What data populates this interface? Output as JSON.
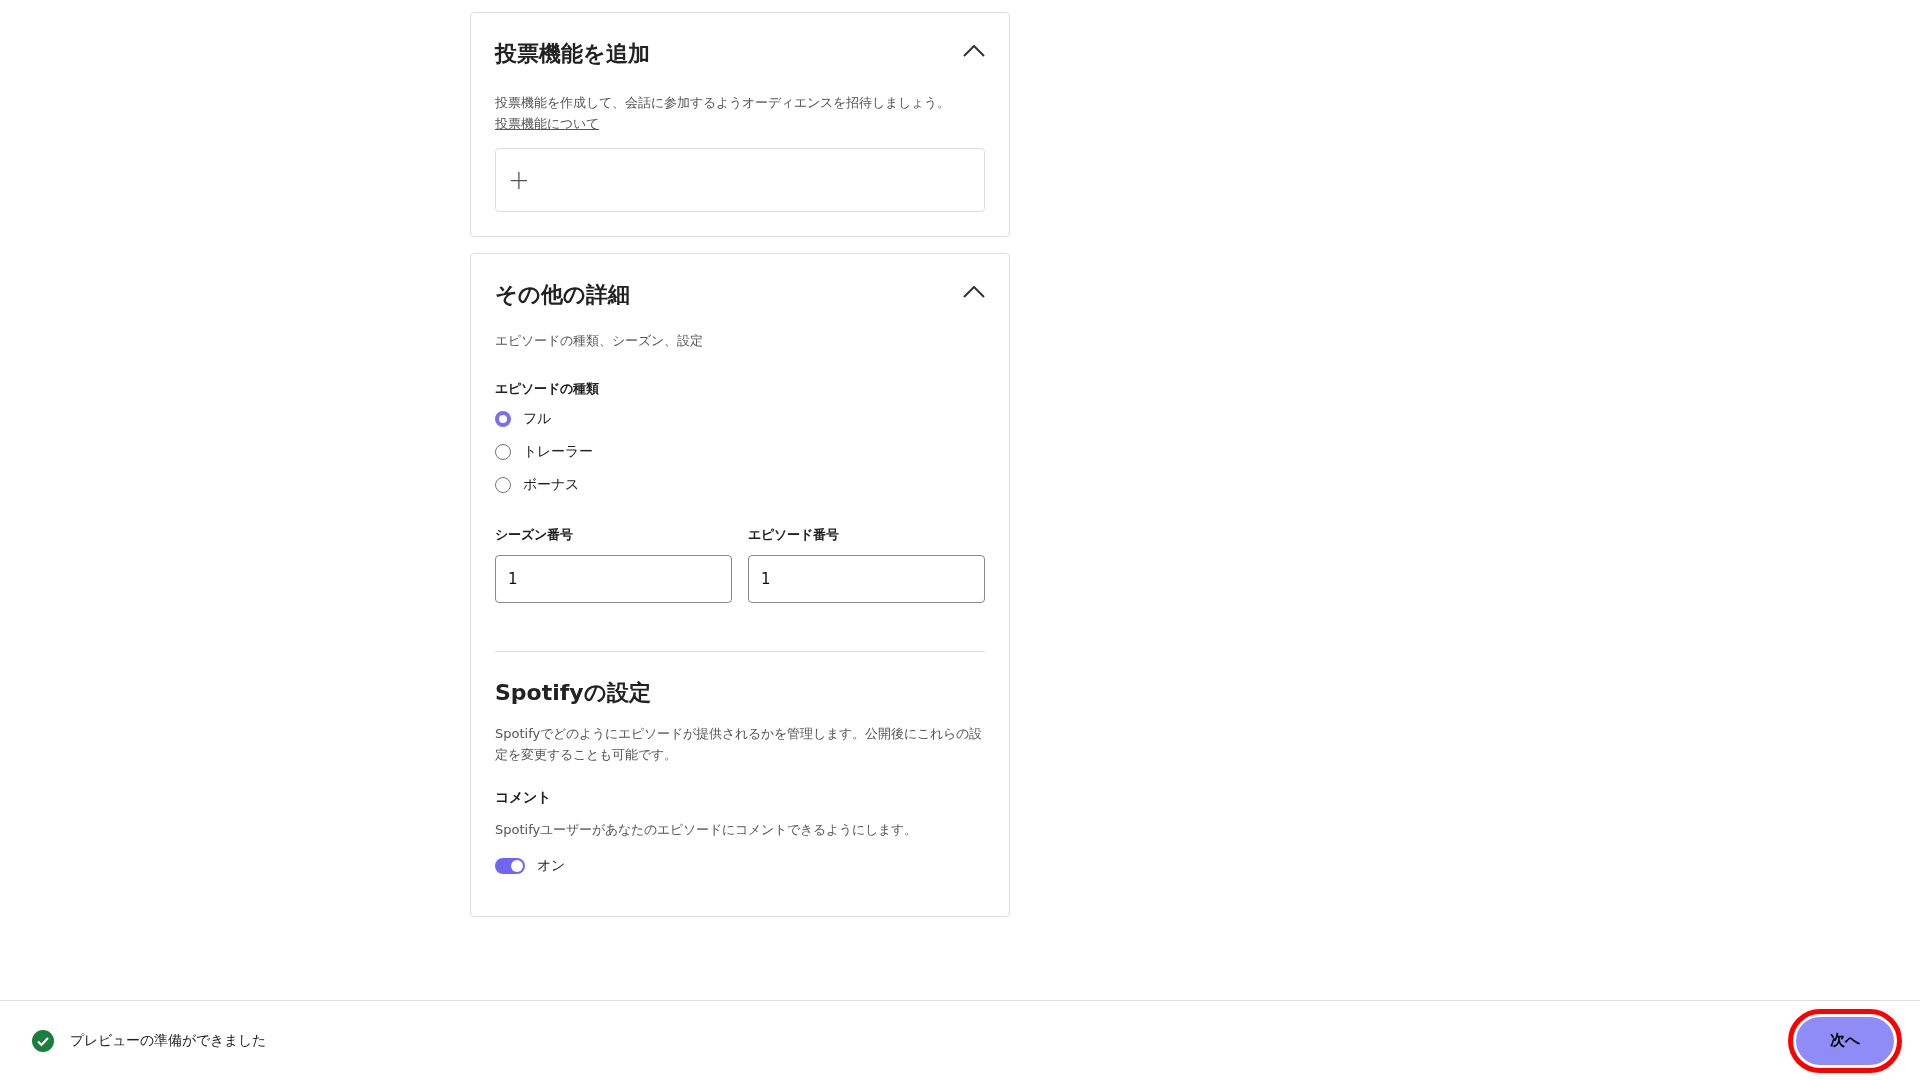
{
  "poll_section": {
    "title": "投票機能を追加",
    "expanded": true,
    "description": "投票機能を作成して、会話に参加するようオーディエンスを招待しましょう。",
    "link": "投票機能について",
    "add_symbol": "+"
  },
  "details_section": {
    "title": "その他の詳細",
    "expanded": true,
    "subtitle": "エピソードの種類、シーズン、設定",
    "episode_type": {
      "label": "エピソードの種類",
      "options": [
        {
          "label": "フル",
          "selected": true
        },
        {
          "label": "トレーラー",
          "selected": false
        },
        {
          "label": "ボーナス",
          "selected": false
        }
      ]
    },
    "fields": [
      {
        "label": "シーズン番号",
        "value": "1"
      },
      {
        "label": "エピソード番号",
        "value": "1"
      }
    ],
    "spotify": {
      "title": "Spotifyの設定",
      "description": "Spotifyでどのようにエピソードが提供されるかを管理します。公開後にこれらの設定を変更することも可能です。",
      "comments": {
        "label": "コメント",
        "description": "Spotifyユーザーがあなたのエピソードにコメントできるようにします。",
        "on": true,
        "state_label": "オン"
      }
    }
  },
  "footer": {
    "status": "プレビューの準備ができました",
    "next_button": {
      "label": "次へ",
      "highlighted": true
    }
  }
}
